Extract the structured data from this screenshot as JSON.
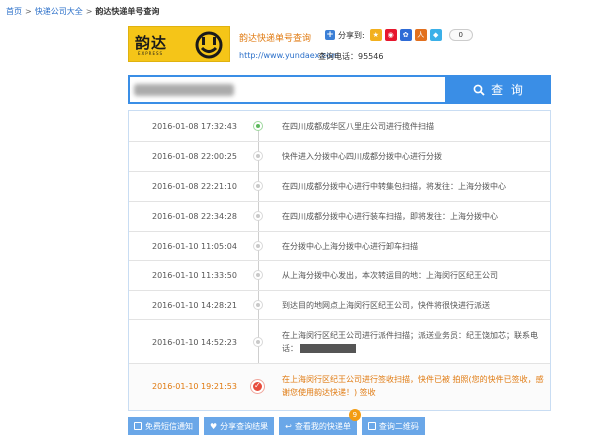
{
  "breadcrumb": {
    "home": "首页",
    "category": "快递公司大全",
    "current": "韵达快递单号查询"
  },
  "company": {
    "logo_text": "韵达",
    "logo_sub": "EXPRESS",
    "title": "韵达快递单号查询",
    "website": "http://www.yundaex.com",
    "phone": "查询电话：95546"
  },
  "share": {
    "label": "分享到:",
    "count": "0",
    "icons": [
      "qzone-icon",
      "weibo-icon",
      "baidu-icon",
      "renren-icon",
      "tqq-icon"
    ]
  },
  "search": {
    "button_label": "查 询"
  },
  "tracking": [
    {
      "time": "2016-01-08 17:32:43",
      "desc": "在四川成都成华区八里庄公司进行揽件扫描",
      "status": "first"
    },
    {
      "time": "2016-01-08 22:00:25",
      "desc": "快件进入分拨中心四川成都分拨中心进行分拨",
      "status": "normal"
    },
    {
      "time": "2016-01-08 22:21:10",
      "desc": "在四川成都分拨中心进行中转集包扫描，将发往：上海分拨中心",
      "status": "normal"
    },
    {
      "time": "2016-01-08 22:34:28",
      "desc": "在四川成都分拨中心进行装车扫描，即将发往：上海分拨中心",
      "status": "normal"
    },
    {
      "time": "2016-01-10 11:05:04",
      "desc": "在分拨中心上海分拨中心进行卸车扫描",
      "status": "normal"
    },
    {
      "time": "2016-01-10 11:33:50",
      "desc": "从上海分拨中心发出，本次转运目的地：上海闵行区纪王公司",
      "status": "normal"
    },
    {
      "time": "2016-01-10 14:28:21",
      "desc": "到达目的地网点上海闵行区纪王公司，快件将很快进行派送",
      "status": "normal"
    },
    {
      "time": "2016-01-10 14:52:23",
      "desc": "在上海闵行区纪王公司进行派件扫描；派送业务员：纪王饶加芯；联系电话：",
      "status": "normal"
    },
    {
      "time": "2016-01-10 19:21:53",
      "desc": "在上海闵行区纪王公司进行签收扫描，快件已被 拍照(您的快件已签收，感谢您使用韵达快递！) 签收",
      "status": "delivered"
    }
  ],
  "actions": [
    {
      "label": "免费短信通知",
      "badge": ""
    },
    {
      "label": "分享查询结果",
      "badge": ""
    },
    {
      "label": "查看我的快递单",
      "badge": "9"
    },
    {
      "label": "查询二维码",
      "badge": ""
    }
  ],
  "colors": {
    "accent": "#3a8ee6",
    "brand": "#f5c518",
    "highlight": "#e07a10",
    "delivered": "#e74c3c",
    "first": "#5cb85c"
  }
}
